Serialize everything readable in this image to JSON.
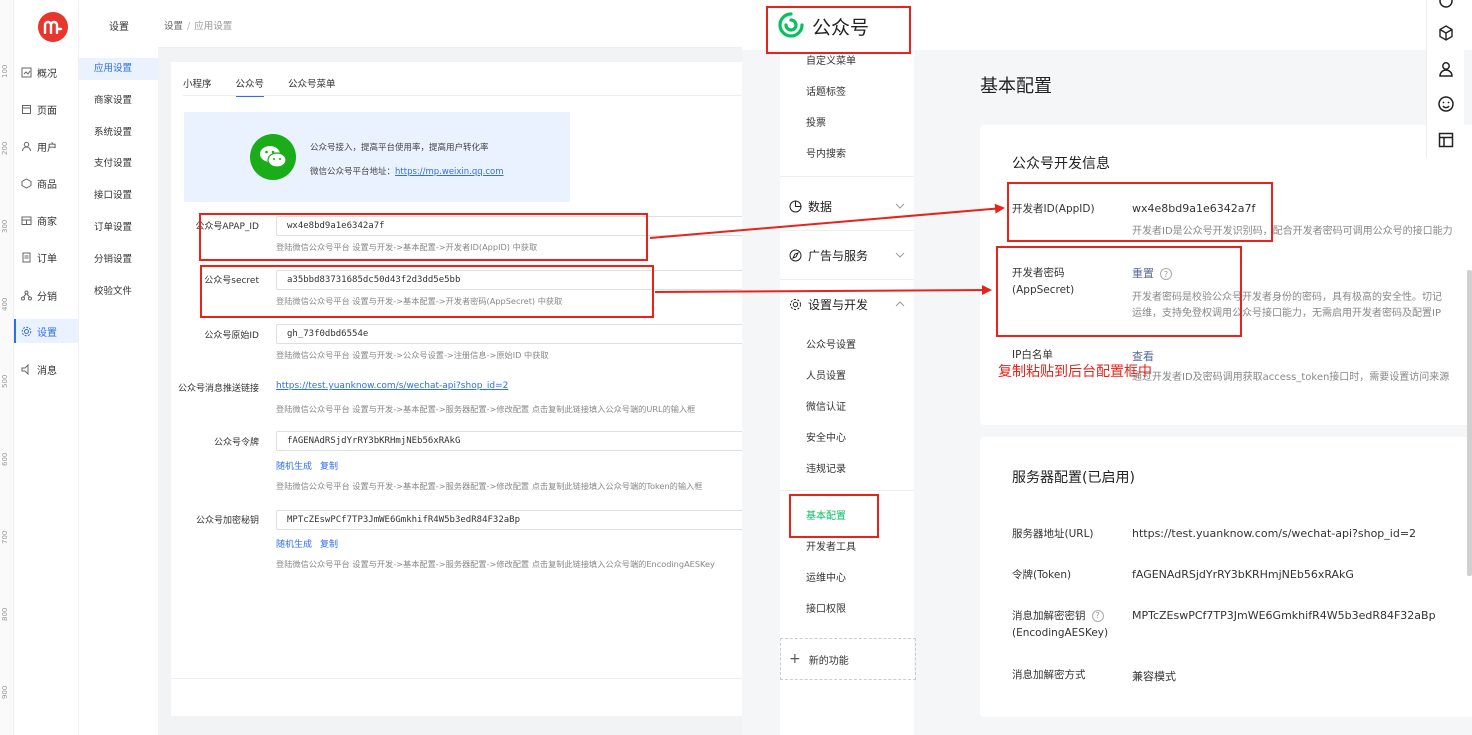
{
  "ruler": [
    "100",
    "200",
    "300",
    "400",
    "500",
    "600",
    "700",
    "800",
    "900"
  ],
  "main_nav": [
    {
      "label": "概况",
      "icon": "overview-icon"
    },
    {
      "label": "页面",
      "icon": "page-icon"
    },
    {
      "label": "用户",
      "icon": "user-icon"
    },
    {
      "label": "商品",
      "icon": "goods-icon"
    },
    {
      "label": "商家",
      "icon": "merchant-icon"
    },
    {
      "label": "订单",
      "icon": "order-icon"
    },
    {
      "label": "分销",
      "icon": "distribution-icon"
    },
    {
      "label": "设置",
      "icon": "settings-icon"
    },
    {
      "label": "消息",
      "icon": "message-icon"
    }
  ],
  "sub_nav": {
    "title": "设置",
    "items": [
      "应用设置",
      "商家设置",
      "系统设置",
      "支付设置",
      "接口设置",
      "订单设置",
      "分销设置",
      "校验文件"
    ]
  },
  "breadcrumb": {
    "root": "设置",
    "sep": "/",
    "current": "应用设置"
  },
  "tabs": [
    "小程序",
    "公众号",
    "公众号菜单"
  ],
  "info": {
    "line1": "公众号接入，提高平台使用率，提高用户转化率",
    "line2_prefix": "微信公众号平台地址：",
    "line2_link": "https://mp.weixin.qq.com"
  },
  "form": {
    "appid": {
      "label": "公众号APAP_ID",
      "value": "wx4e8bd9a1e6342a7f",
      "hint": "登陆微信公众号平台 设置与开发->基本配置->开发者ID(AppID) 中获取"
    },
    "secret": {
      "label": "公众号secret",
      "value": "a35bbd83731685dc50d43f2d3dd5e5bb",
      "hint": "登陆微信公众号平台 设置与开发->基本配置->开发者密码(AppSecret) 中获取"
    },
    "origin_id": {
      "label": "公众号原始ID",
      "value": "gh_73f0dbd6554e",
      "hint": "登陆微信公众号平台 设置与开发->公众号设置->注册信息->原始ID 中获取"
    },
    "push_link": {
      "label": "公众号消息推送链接",
      "value": "https://test.yuanknow.com/s/wechat-api?shop_id=2",
      "hint": "登陆微信公众号平台 设置与开发->基本配置->服务器配置->修改配置 点击复制此链接填入公众号端的URL的输入框"
    },
    "token": {
      "label": "公众号令牌",
      "value": "fAGENAdRSjdYrRY3bKRHmjNEb56xRAkG",
      "random": "随机生成",
      "copy": "复制",
      "hint": "登陆微信公众号平台 设置与开发->基本配置->服务器配置->修改配置 点击复制此链接填入公众号端的Token的输入框"
    },
    "aes_key": {
      "label": "公众号加密秘钥",
      "value": "MPTcZEswPCf7TP3JmWE6GmkhifR4W5b3edR84F32aBp",
      "random": "随机生成",
      "copy": "复制",
      "hint": "登陆微信公众号平台 设置与开发->基本配置->服务器配置->修改配置 点击复制此链接填入公众号端的EncodingAESKey"
    }
  },
  "mp": {
    "title": "公众号",
    "nav_top": [
      "自定义菜单",
      "话题标签",
      "投票",
      "号内搜索"
    ],
    "groups": [
      {
        "label": "数据",
        "icon": "data-icon"
      },
      {
        "label": "广告与服务",
        "icon": "ad-icon"
      },
      {
        "label": "设置与开发",
        "icon": "settings-icon"
      }
    ],
    "nav_dev": [
      "公众号设置",
      "人员设置",
      "微信认证",
      "安全中心",
      "违规记录"
    ],
    "nav_dev2": [
      "基本配置",
      "开发者工具",
      "运维中心",
      "接口权限"
    ],
    "new_func": "新的功能",
    "page_title": "基本配置",
    "dev_card": {
      "title": "公众号开发信息",
      "appid_label": "开发者ID(AppID)",
      "appid_value": "wx4e8bd9a1e6342a7f",
      "appid_desc": "开发者ID是公众号开发识别码，配合开发者密码可调用公众号的接口能力",
      "secret_label": "开发者密码(AppSecret)",
      "secret_action": "重置",
      "secret_desc1": "开发者密码是校验公众号开发者身份的密码，具有极高的安全性。切记",
      "secret_desc2": "运维，支持免登权调用公众号接口能力，无需启用开发者密码及配置IP",
      "ip_label": "IP白名单",
      "ip_action": "查看",
      "ip_desc": "通过开发者ID及密码调用获取access_token接口时，需要设置访问来源"
    },
    "server_card": {
      "title": "服务器配置(已启用)",
      "url_label": "服务器地址(URL)",
      "url_value": "https://test.yuanknow.com/s/wechat-api?shop_id=2",
      "token_label": "令牌(Token)",
      "token_value": "fAGENAdRSjdYrRY3bKRHmjNEb56xRAkG",
      "aes_label1": "消息加解密密钥",
      "aes_label2": "(EncodingAESKey)",
      "aes_value": "MPTcZEswPCf7TP3JmWE6GmkhifR4W5b3edR84F32aBp",
      "mode_label": "消息加解密方式",
      "mode_value": "兼容模式"
    }
  },
  "annotation": "复制粘贴到后台配置框中",
  "colors": {
    "accent": "#2f6fea",
    "wechat_green": "#07c160",
    "annotation_red": "#e8231a"
  }
}
